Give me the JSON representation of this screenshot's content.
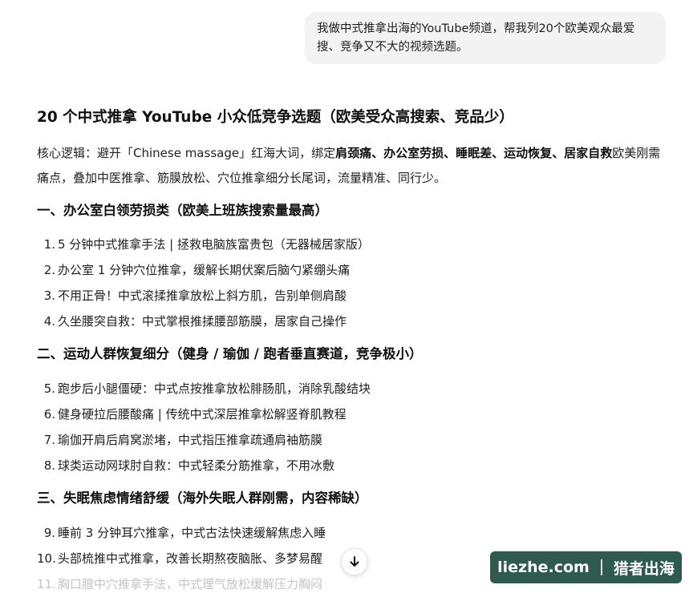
{
  "user_message": "我做中式推拿出海的YouTube频道，帮我列20个欧美观众最爱搜、竞争又不大的视频选题。",
  "answer": {
    "title": "20 个中式推拿 YouTube 小众低竞争选题（欧美受众高搜索、竞品少）",
    "intro": {
      "prefix": "核心逻辑：避开「Chinese massage」红海大词，绑定",
      "bold_1": "肩颈痛",
      "sep_1": "、",
      "bold_2": "办公室劳损",
      "sep_2": "、",
      "bold_3": "睡眠差",
      "sep_3": "、",
      "bold_4": "运动恢复",
      "sep_4": "、",
      "bold_5": "居家自救",
      "suffix": "欧美刚需痛点，叠加中医推拿、筋膜放松、穴位推拿细分长尾词，流量精准、同行少。"
    },
    "sections": [
      {
        "heading": "一、办公室白领劳损类（欧美上班族搜索量最高）",
        "items": [
          {
            "num": "1.",
            "text": "5 分钟中式推拿手法 | 拯救电脑族富贵包（无器械居家版）"
          },
          {
            "num": "2.",
            "text": "办公室 1 分钟穴位推拿，缓解长期伏案后脑勺紧绷头痛"
          },
          {
            "num": "3.",
            "text": "不用正骨！中式滚揉推拿放松上斜方肌，告别单侧肩酸"
          },
          {
            "num": "4.",
            "text": "久坐腰突自救：中式掌根推揉腰部筋膜，居家自己操作"
          }
        ]
      },
      {
        "heading": "二、运动人群恢复细分（健身 / 瑜伽 / 跑者垂直赛道，竞争极小）",
        "items": [
          {
            "num": "5.",
            "text": "跑步后小腿僵硬：中式点按推拿放松腓肠肌，消除乳酸结块"
          },
          {
            "num": "6.",
            "text": "健身硬拉后腰酸痛 | 传统中式深层推拿松解竖脊肌教程"
          },
          {
            "num": "7.",
            "text": "瑜伽开肩后肩窝淤堵，中式指压推拿疏通肩袖筋膜"
          },
          {
            "num": "8.",
            "text": "球类运动网球肘自救：中式轻柔分筋推拿，不用冰敷"
          }
        ]
      },
      {
        "heading": "三、失眠焦虑情绪舒缓（海外失眠人群刚需，内容稀缺）",
        "items": [
          {
            "num": "9.",
            "text": "睡前 3 分钟耳穴推拿，中式古法快速缓解焦虑入睡"
          },
          {
            "num": "10.",
            "text": "头部梳推中式推拿，改善长期熬夜脑胀、多梦易醒"
          },
          {
            "num": "11.",
            "text": "胸口膻中穴推拿手法，中式理气放松缓解压力胸闷"
          }
        ]
      }
    ]
  },
  "scroll_button": {
    "icon": "arrow-down-icon"
  },
  "watermark": {
    "domain": "liezhe.com",
    "brand": "猎者出海",
    "color": "#2f5a4f"
  }
}
